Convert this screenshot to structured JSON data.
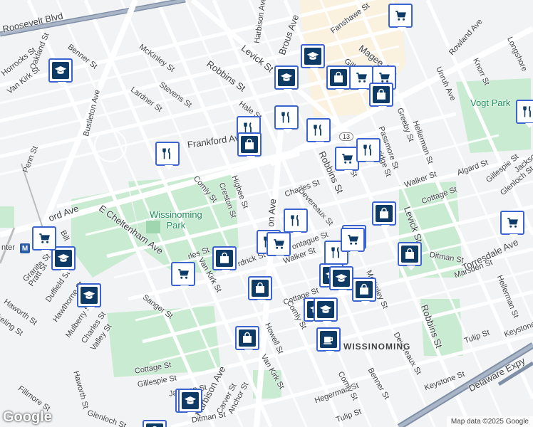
{
  "map": {
    "park_names": {
      "wissinoming": "Wissinoming\nPark",
      "vogt": "Vogt Park"
    },
    "neighborhood": "WISSINOMING",
    "route_badge": "13",
    "metro_letter": "M",
    "metro_partial_label": "nter",
    "attribution": "Map data ©2025 Google",
    "logo": "Google",
    "colors": {
      "park": "#c8ebd2",
      "road": "#ffffff",
      "highway": "#7f8fa6",
      "pin_border": "#3b63d0",
      "pin_icon": "#0d3b66"
    },
    "streets": {
      "roosevelt": "Roosevelt Blvd",
      "benner_nw": "Benner St",
      "oakland": "Oakland St",
      "horrocks": "Horrocks St",
      "vankirk_nw": "Van Kirk St",
      "mckinley_nw": "McKinley St",
      "bustleton": "Bustleton Ave",
      "stevens": "Stevens St",
      "lardner": "Lardner St",
      "robbins_n": "Robbins St",
      "levick_n": "Levick St",
      "harbison_n": "Harbison Ave",
      "brous": "Brous Ave",
      "fanshawe": "Fanshawe St",
      "magee": "Magee Ave",
      "rowland": "Rowland Ave",
      "knorr": "Knorr St",
      "longshore": "Longshore",
      "unruh": "Unruh Ave",
      "hale": "Hale St",
      "frankford": "Frankford Ave",
      "penn": "Penn St",
      "comly_w": "Comly St",
      "creston": "Creston St",
      "higbee": "Higbee St",
      "oxford": "ord Ave",
      "e_cheltenham": "E Cheltenham Ave",
      "bill": "Bill",
      "granite": "Granite St",
      "pratt": "Pratt St",
      "duffield": "Duffield St",
      "haworth_w": "Haworth St",
      "keeling": "keling St",
      "hawthorne": "Hawthorne St",
      "mulberry": "Mulberry St",
      "charles_w": "Charles St",
      "valley": "Valley St",
      "sanger": "Sanger St",
      "haworth_s": "Haworth St",
      "fillmore": "Fillmore St",
      "glenloch_s": "Glenloch St",
      "cottage_sw": "Cottage St",
      "gillespie_sw": "Gillespie St",
      "jackson_sw": "Jackson St",
      "harbison_s": "Harbison Ave",
      "anchor": "Anchor St",
      "carver": "Carver St",
      "ditman_s": "Ditman St",
      "vankirk_w": "Van Kirk St",
      "charles_mid": "rles St",
      "frankford_mid": "rdrick St",
      "mon_ave": "on Ave",
      "charles_c": "Charles St",
      "devereaux_c": "Devereaux St",
      "montague": "ontague St",
      "walker_c": "Walker St",
      "cottage_c": "Cottage St",
      "comly_c": "Comly St",
      "howell": "Howell St",
      "vankirk_s": "Van Kirk St",
      "mckinley_c": "McKinley St",
      "robbins_c": "Robbins St",
      "hegerman_s": "Hegerman St",
      "comly_s": "Comly St",
      "tulip_s": "Tulip St",
      "benner_s": "Benner St",
      "devereaux_s": "Devereaux St",
      "keystone": "Keystone St",
      "robbins_se": "Robbins St",
      "tulip_se": "Tulip St",
      "delaware": "Delaware Expy",
      "keystone_e": "Keystone",
      "torresdale": "Torresdale Ave",
      "hellerman_se": "Hellerman St",
      "marsden": "Marsden St",
      "ditman_e": "Ditman St",
      "cottage_e": "Cottage St",
      "levick_e": "Levick St",
      "walker_e": "Walker St",
      "algard": "Algard St",
      "gillespie_e": "Gillespie St",
      "jackson_e": "Jackson St",
      "glenloch_e": "Glenloch St",
      "passmore": "Passmore St",
      "greeby": "Greeby St",
      "hellerman_n": "Hellerman St",
      "robbins_rd": "Robbins St",
      "ridge": "ridge St",
      "g_ave": "g St",
      "gill": "Gill"
    },
    "pins": [
      {
        "type": "cart"
      },
      {
        "type": "school"
      },
      {
        "type": "school"
      },
      {
        "type": "school"
      },
      {
        "type": "bag"
      },
      {
        "type": "cart"
      },
      {
        "type": "cart"
      },
      {
        "type": "bag"
      },
      {
        "type": "dine"
      },
      {
        "type": "dine"
      },
      {
        "type": "dine"
      },
      {
        "type": "bag"
      },
      {
        "type": "dine"
      },
      {
        "type": "cart"
      },
      {
        "type": "dine"
      },
      {
        "type": "dine"
      },
      {
        "type": "bag"
      },
      {
        "type": "cart"
      },
      {
        "type": "cart"
      },
      {
        "type": "bag"
      },
      {
        "type": "school"
      },
      {
        "type": "cart"
      },
      {
        "type": "dine"
      },
      {
        "type": "dine"
      },
      {
        "type": "bag"
      },
      {
        "type": "bag"
      },
      {
        "type": "school"
      },
      {
        "type": "school"
      },
      {
        "type": "cart"
      },
      {
        "type": "school"
      },
      {
        "type": "school"
      },
      {
        "type": "school"
      },
      {
        "type": "bag"
      },
      {
        "type": "coffee"
      },
      {
        "type": "school"
      },
      {
        "type": "dine"
      },
      {
        "type": "bag"
      },
      {
        "type": "cart"
      },
      {
        "type": "cart"
      },
      {
        "type": "bag"
      },
      {
        "type": "school"
      }
    ]
  }
}
